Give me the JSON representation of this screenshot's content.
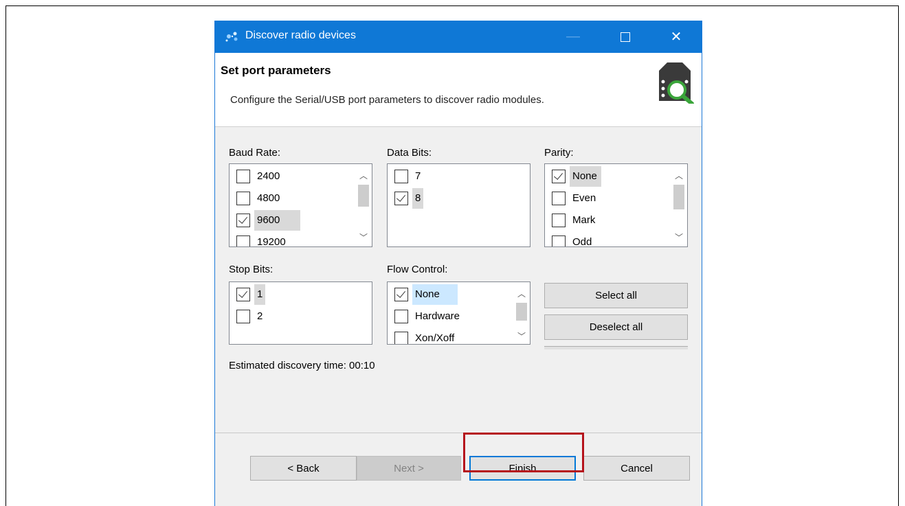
{
  "window": {
    "title": "Discover radio devices"
  },
  "header": {
    "title": "Set port parameters",
    "description": "Configure the Serial/USB port parameters to discover radio modules.",
    "icon": "radio-search-icon"
  },
  "baud_rate": {
    "label": "Baud Rate:",
    "items": [
      {
        "label": "2400",
        "checked": false
      },
      {
        "label": "4800",
        "checked": false
      },
      {
        "label": "9600",
        "checked": true
      },
      {
        "label": "19200",
        "checked": false
      }
    ]
  },
  "data_bits": {
    "label": "Data Bits:",
    "items": [
      {
        "label": "7",
        "checked": false
      },
      {
        "label": "8",
        "checked": true
      }
    ]
  },
  "parity": {
    "label": "Parity:",
    "items": [
      {
        "label": "None",
        "checked": true
      },
      {
        "label": "Even",
        "checked": false
      },
      {
        "label": "Mark",
        "checked": false
      },
      {
        "label": "Odd",
        "checked": false
      }
    ]
  },
  "stop_bits": {
    "label": "Stop Bits:",
    "items": [
      {
        "label": "1",
        "checked": true
      },
      {
        "label": "2",
        "checked": false
      }
    ]
  },
  "flow_control": {
    "label": "Flow Control:",
    "items": [
      {
        "label": "None",
        "checked": true
      },
      {
        "label": "Hardware",
        "checked": false
      },
      {
        "label": "Xon/Xoff",
        "checked": false
      }
    ]
  },
  "actions": {
    "select_all": "Select all",
    "deselect_all": "Deselect all"
  },
  "estimate": {
    "text": "Estimated discovery time: 00:10"
  },
  "footer": {
    "back": "< Back",
    "next": "Next >",
    "finish": "Finish",
    "cancel": "Cancel"
  },
  "colors": {
    "titlebar": "#0f78d6",
    "highlight": "#b5121b"
  }
}
